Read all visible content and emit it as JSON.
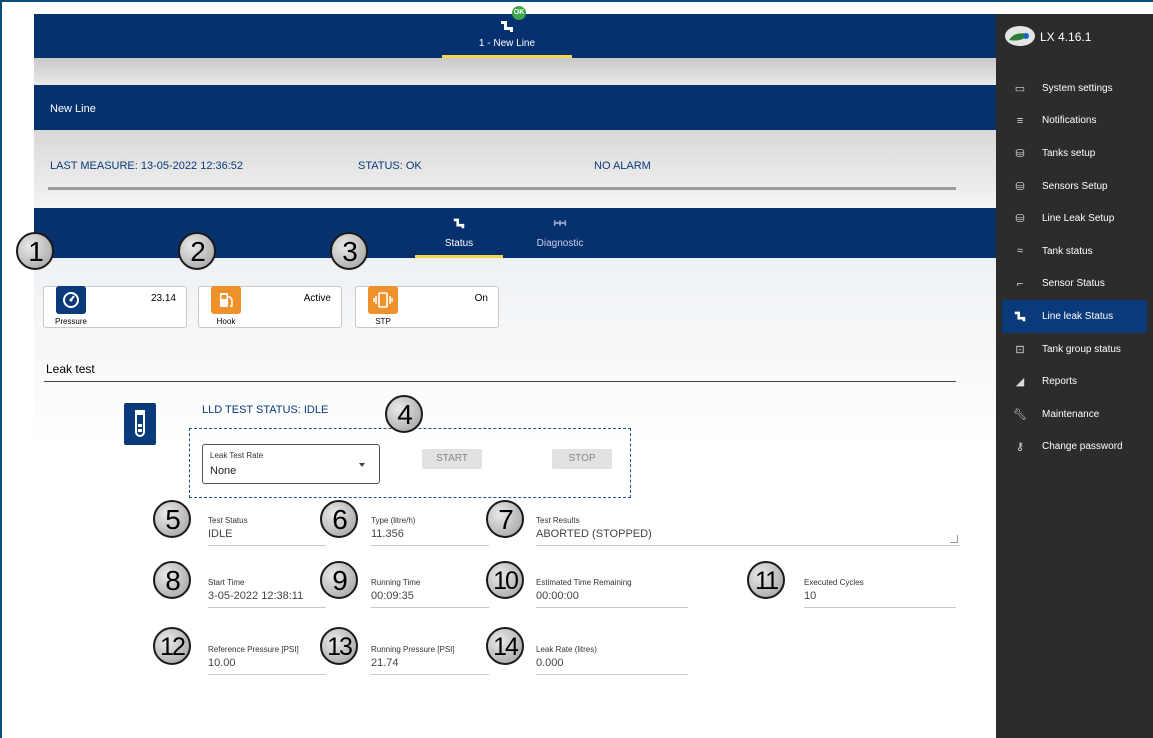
{
  "header": {
    "line_tab_label": "1 - New Line",
    "ok_badge": "OK"
  },
  "line_name": "New Line",
  "info": {
    "last_measure": "LAST MEASURE: 13-05-2022 12:36:52",
    "status": "STATUS: OK",
    "alarm": "NO ALARM"
  },
  "tabs": [
    {
      "label": "Status",
      "icon": "line-leak-icon"
    },
    {
      "label": "Diagnostic",
      "icon": "diagnostic-icon"
    }
  ],
  "cards": [
    {
      "caption": "Pressure",
      "value": "23.14",
      "icon": "gauge-icon",
      "color": "#0b3a7a"
    },
    {
      "caption": "Hook",
      "value": "Active",
      "icon": "fuel-pump-icon",
      "color": "#f0922b"
    },
    {
      "caption": "STP",
      "value": "On",
      "icon": "vibration-icon",
      "color": "#f0922b"
    }
  ],
  "badges": [
    "1",
    "2",
    "3",
    "4",
    "5",
    "6",
    "7",
    "8",
    "9",
    "10",
    "11",
    "12",
    "13",
    "14"
  ],
  "leak_test": {
    "section_title": "Leak test",
    "status_title": "LLD TEST STATUS: IDLE",
    "rate_label": "Leak Test Rate",
    "rate_value": "None",
    "start_label": "START",
    "stop_label": "STOP"
  },
  "fields": {
    "test_status": {
      "label": "Test Status",
      "value": "IDLE"
    },
    "type": {
      "label": "Type (litre/h)",
      "value": "11.356"
    },
    "test_results": {
      "label": "Test Results",
      "value": "ABORTED (STOPPED)"
    },
    "start_time": {
      "label": "Start Time",
      "value": "3-05-2022 12:38:11"
    },
    "running_time": {
      "label": "Running Time",
      "value": "00:09:35"
    },
    "est_remaining": {
      "label": "Estimated Time Remaining",
      "value": "00:00:00"
    },
    "executed_cycles": {
      "label": "Executed Cycles",
      "value": "10"
    },
    "ref_pressure": {
      "label": "Reference Pressure [PSI]",
      "value": "10.00"
    },
    "running_pressure": {
      "label": "Running Pressure [PSI]",
      "value": "21.74"
    },
    "leak_rate": {
      "label": "Leak Rate (litres)",
      "value": "0.000"
    }
  },
  "sidebar": {
    "version": "LX 4.16.1",
    "items": [
      {
        "label": "System settings",
        "icon": "monitor-icon"
      },
      {
        "label": "Notifications",
        "icon": "notifications-icon"
      },
      {
        "label": "Tanks setup",
        "icon": "database-icon"
      },
      {
        "label": "Sensors Setup",
        "icon": "database-icon"
      },
      {
        "label": "Line Leak Setup",
        "icon": "database-icon"
      },
      {
        "label": "Tank status",
        "icon": "waves-icon"
      },
      {
        "label": "Sensor Status",
        "icon": "cast-icon"
      },
      {
        "label": "Line leak Status",
        "icon": "line-leak-icon"
      },
      {
        "label": "Tank group status",
        "icon": "group-icon"
      },
      {
        "label": "Reports",
        "icon": "chart-icon"
      },
      {
        "label": "Maintenance",
        "icon": "wrench-icon"
      },
      {
        "label": "Change password",
        "icon": "key-icon"
      }
    ]
  }
}
